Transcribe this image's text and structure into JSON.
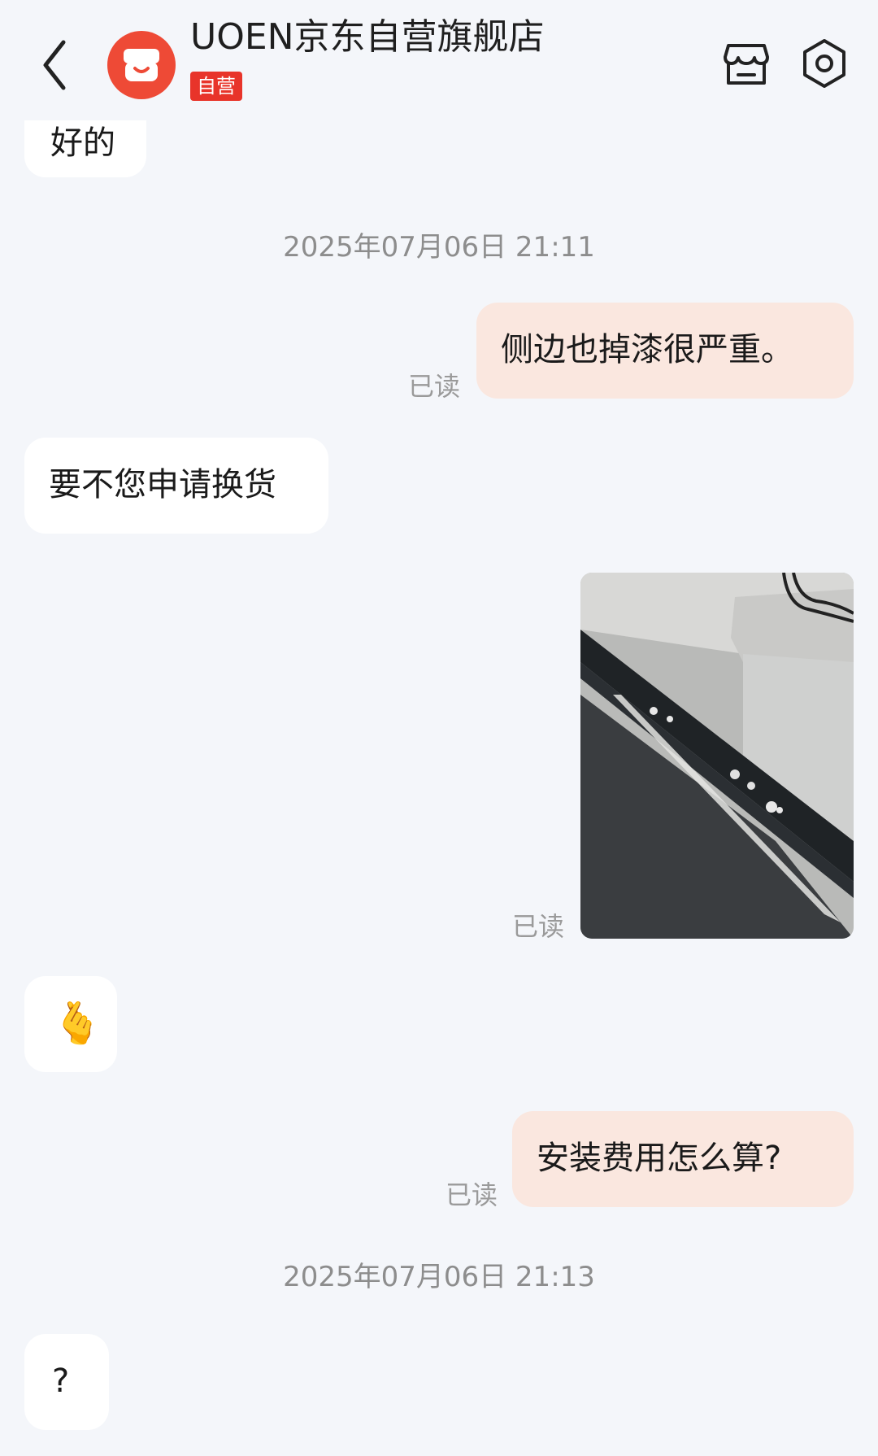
{
  "header": {
    "shop_name": "UOEN京东自营旗舰店",
    "badge": "自营",
    "accent_color": "#e8342a"
  },
  "messages": {
    "recv_1": "好的",
    "timestamp_1": "2025年07月06日 21:11",
    "sent_1": "侧边也掉漆很严重。",
    "sent_1_status": "已读",
    "recv_2": "要不您申请换货",
    "photo_status": "已读",
    "recv_3_emoji": "🫰",
    "sent_2": "安装费用怎么算?",
    "sent_2_status": "已读",
    "timestamp_2": "2025年07月06日 21:13",
    "recv_4": "?"
  },
  "icons": {
    "back": "chevron-left-icon",
    "shop": "storefront-icon",
    "settings": "hexagon-settings-icon"
  }
}
